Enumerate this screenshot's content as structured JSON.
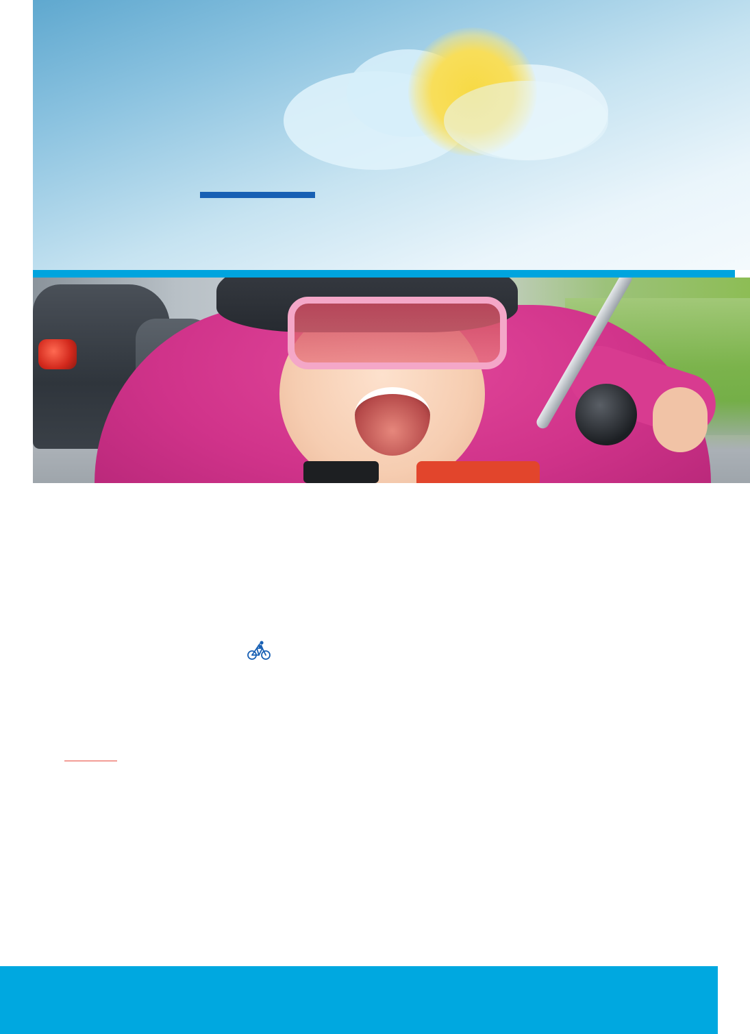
{
  "document": {
    "banner": {
      "sky_color_top": "#5fa8cf",
      "sky_color_bottom": "#f4fafd",
      "sun_icon": "sun-icon",
      "cloud_icon": "cloud-icon",
      "accent_underline_color": "#1860b4"
    },
    "strip": {
      "color": "#00a4de"
    },
    "photo": {
      "subject_icon": "child-on-bicycle-photo"
    },
    "body": {
      "bicycle_icon": "bicycle-icon",
      "bicycle_icon_color": "#1860b4",
      "red_rule_color": "#e8463a"
    },
    "footer": {
      "color": "#00a8e0"
    }
  }
}
